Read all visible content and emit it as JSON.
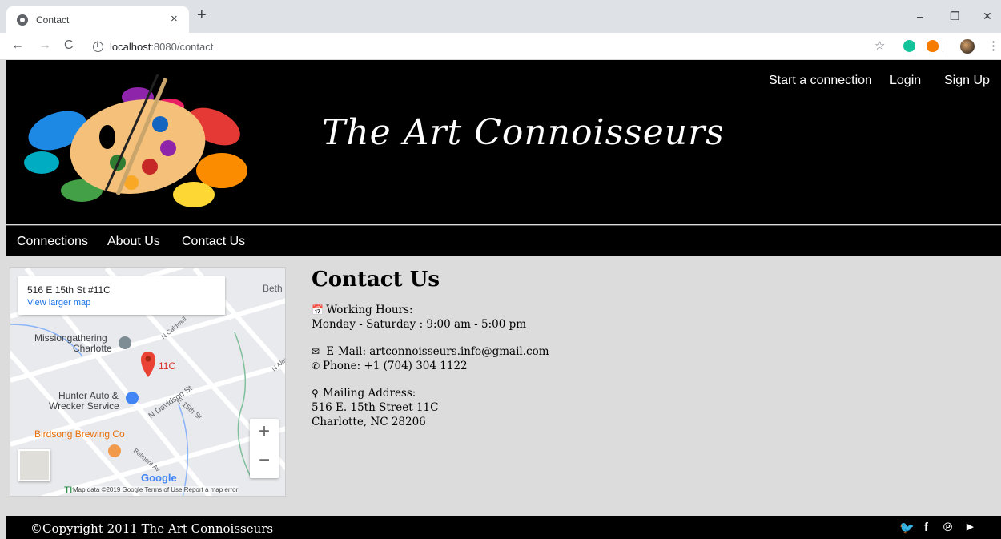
{
  "browser": {
    "tab_title": "Contact",
    "tab_close": "×",
    "new_tab": "+",
    "minimize": "–",
    "restore": "❐",
    "close": "✕",
    "back": "←",
    "forward": "→",
    "reload": "C",
    "url_host": "localhost",
    "url_path": ":8080/contact",
    "bookmark_star": "☆",
    "menu": "⋮"
  },
  "header": {
    "site_title": "The Art Connoisseurs",
    "top_nav": [
      "Start a connection",
      "Login",
      "Sign Up"
    ]
  },
  "main_nav": [
    "Connections",
    "About Us",
    "Contact Us"
  ],
  "map": {
    "address": "516 E 15th St #11C",
    "view_larger": "View larger map",
    "labels": {
      "beth": "Beth",
      "mission": "Missiongathering",
      "charlotte": "Charlotte",
      "pin": "11C",
      "hunter": "Hunter Auto &",
      "wrecker": "Wrecker Service",
      "davidson": "N Davidson St",
      "e15": "E 15th St",
      "birdsong": "Birdsong Brewing Co",
      "belmont": "Belmont Av",
      "caldwell": "N Caldwell",
      "alex": "N Alex",
      "th": "Th"
    },
    "zoom_in": "+",
    "zoom_out": "−",
    "google": "Google",
    "attribution": "Map data ©2019 Google   Terms of Use   Report a map error"
  },
  "contact": {
    "heading": "Contact Us",
    "hours_label": "Working Hours:",
    "hours_value": "Monday - Saturday : 9:00 am - 5:00 pm",
    "email": "E-Mail: artconnoisseurs.info@gmail.com",
    "phone": "Phone: +1 (704) 304 1122",
    "mailing_label": "Mailing Address:",
    "address_line1": "516 E. 15th Street 11C",
    "address_line2": "Charlotte, NC 28206"
  },
  "footer": {
    "copyright": "©Copyright 2011 The Art Connoisseurs",
    "social": [
      "twitter-icon",
      "facebook-icon",
      "pinterest-icon",
      "youtube-icon"
    ]
  }
}
